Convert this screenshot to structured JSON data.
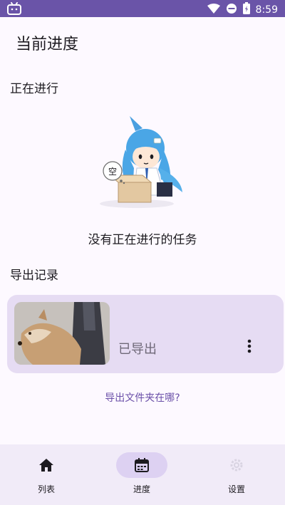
{
  "status_bar": {
    "time": "8:59"
  },
  "header": {
    "title": "当前进度"
  },
  "in_progress": {
    "title": "正在进行",
    "empty_text": "没有正在进行的任务",
    "bubble_text": "空"
  },
  "exports": {
    "title": "导出记录",
    "items": [
      {
        "status": "已导出"
      }
    ],
    "help_link": "导出文件夹在哪?"
  },
  "bottom_nav": {
    "items": [
      {
        "label": "列表",
        "icon": "home-icon",
        "active": false
      },
      {
        "label": "进度",
        "icon": "calendar-icon",
        "active": true
      },
      {
        "label": "设置",
        "icon": "settings-icon",
        "active": false
      }
    ]
  },
  "colors": {
    "accent": "#6a54a8",
    "card_background": "#e6dcf3",
    "nav_background": "#f1ebf8",
    "link": "#6a4fa8"
  }
}
